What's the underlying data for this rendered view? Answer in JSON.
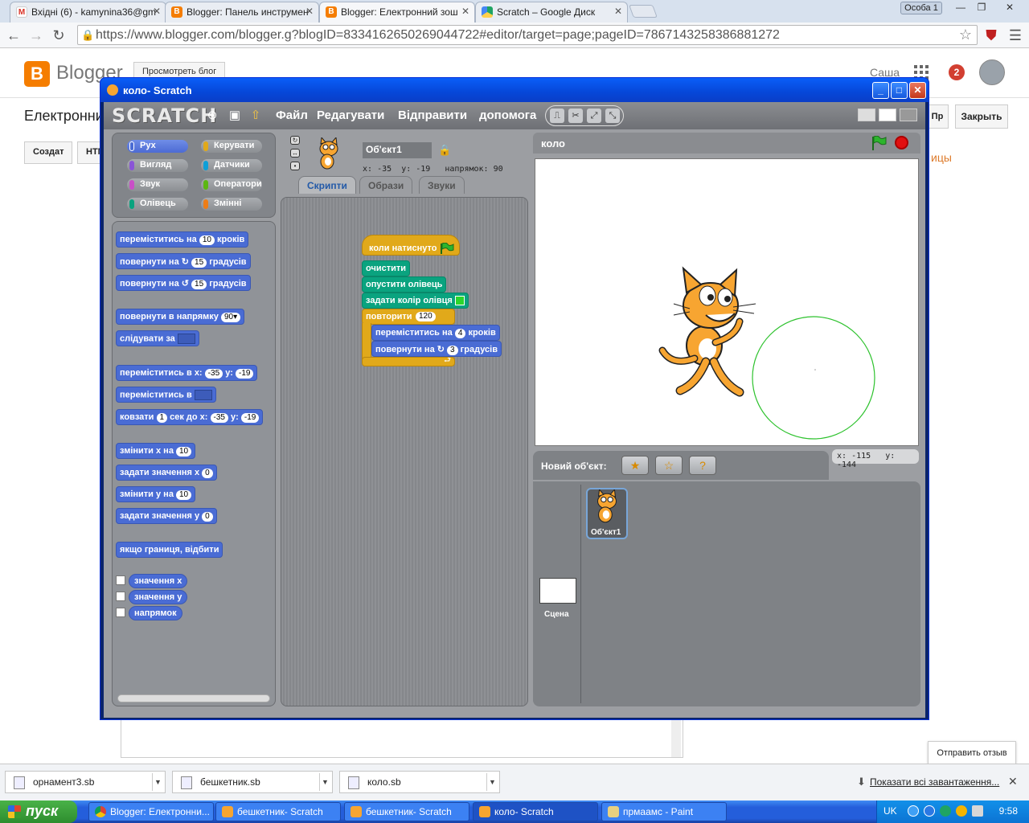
{
  "browser": {
    "tabs": [
      {
        "label": "Вхідні (6) - kamynina36@gm",
        "icon": "gmail-icon"
      },
      {
        "label": "Blogger: Панель инструмен",
        "icon": "blogger-icon"
      },
      {
        "label": "Blogger: Електронний зош",
        "icon": "blogger-icon",
        "active": true
      },
      {
        "label": "Scratch – Google Диск",
        "icon": "drive-icon"
      }
    ],
    "profile": "Особа 1",
    "url": "https://www.blogger.com/blogger.g?blogID=8334162650269044722#editor/target=page;pageID=7867143258386881272"
  },
  "blogger": {
    "logo_text": "Blogger",
    "view_blog": "Просмотреть блог",
    "user": "Саша",
    "notifications": "2",
    "post_title": "Електронни",
    "close_label": "Закрыть",
    "pr_label": "Пр",
    "tab_compose": "Создат",
    "tab_html": "HTM",
    "right_link": "ицы",
    "feedback": "Отправить отзыв"
  },
  "downloads": {
    "items": [
      "орнамент3.sb",
      "бешкетник.sb",
      "коло.sb"
    ],
    "show_all": "Показати всі завантаження..."
  },
  "taskbar": {
    "start": "пуск",
    "tasks": [
      "Blogger: Електронни...",
      "бешкетник- Scratch",
      "бешкетник- Scratch",
      "коло- Scratch",
      "прмаамс - Paint"
    ],
    "lang": "UK",
    "time": "9:58"
  },
  "scratch": {
    "window_title": "коло- Scratch",
    "logo": "SCRATCH",
    "menus": [
      "Файл",
      "Редагувати",
      "Відправити",
      "допомога"
    ],
    "categories": [
      {
        "label": "Рух",
        "color": "#4a6cd4"
      },
      {
        "label": "Керувати",
        "color": "#e1a91a"
      },
      {
        "label": "Вигляд",
        "color": "#8a55d7"
      },
      {
        "label": "Датчики",
        "color": "#0e9fd8"
      },
      {
        "label": "Звук",
        "color": "#c94fc7"
      },
      {
        "label": "Оператори",
        "color": "#5cb712"
      },
      {
        "label": "Олівець",
        "color": "#0aa37f"
      },
      {
        "label": "Змінні",
        "color": "#ee7d16"
      }
    ],
    "palette": {
      "move": {
        "pre": "переміститись на",
        "val": "10",
        "post": "кроків"
      },
      "turn_right": {
        "pre": "повернути на",
        "val": "15",
        "post": "градусів"
      },
      "turn_left": {
        "pre": "повернути на",
        "val": "15",
        "post": "градусів"
      },
      "point_dir": {
        "pre": "повернути в напрямку",
        "val": "90▾"
      },
      "point_towards": {
        "pre": "слідувати за"
      },
      "goto_xy": {
        "pre": "переміститись в x:",
        "x": "-35",
        "ylabel": "y:",
        "y": "-19"
      },
      "goto": {
        "pre": "переміститись в"
      },
      "glide": {
        "pre": "ковзати",
        "secs": "1",
        "mid": "сек до x:",
        "x": "-35",
        "ylabel": "y:",
        "y": "-19"
      },
      "change_x": {
        "pre": "змінити х на",
        "val": "10"
      },
      "set_x": {
        "pre": "задати значення х",
        "val": "0"
      },
      "change_y": {
        "pre": "змінити у на",
        "val": "10"
      },
      "set_y": {
        "pre": "задати значення у",
        "val": "0"
      },
      "bounce": "якщо границя, відбити",
      "rep_x": "значення х",
      "rep_y": "значення у",
      "rep_dir": "напрямок"
    },
    "sprite": {
      "name": "Об'єкт1",
      "x_label": "x:",
      "x": "-35",
      "y_label": "y:",
      "y": "-19",
      "dir_label": "напрямок:",
      "dir": "90"
    },
    "tabs": [
      "Скрипти",
      "Образи",
      "Звуки"
    ],
    "script": {
      "hat": "коли натиснуто",
      "clear": "очистити",
      "pen_down": "опустити олівець",
      "set_color": "задати колір олівця",
      "repeat": "повторити",
      "repeat_n": "120",
      "move": {
        "pre": "переміститись на",
        "val": "4",
        "post": "кроків"
      },
      "turn": {
        "pre": "повернути на",
        "val": "3",
        "post": "градусів"
      }
    },
    "stage": {
      "name": "коло",
      "mouse_x_label": "x:",
      "mouse_x": "-115",
      "mouse_y_label": "y:",
      "mouse_y": "-144"
    },
    "new_sprite_label": "Новий об'єкт:",
    "stage_label": "Сцена",
    "sprite_tile": "Об'єкт1"
  }
}
